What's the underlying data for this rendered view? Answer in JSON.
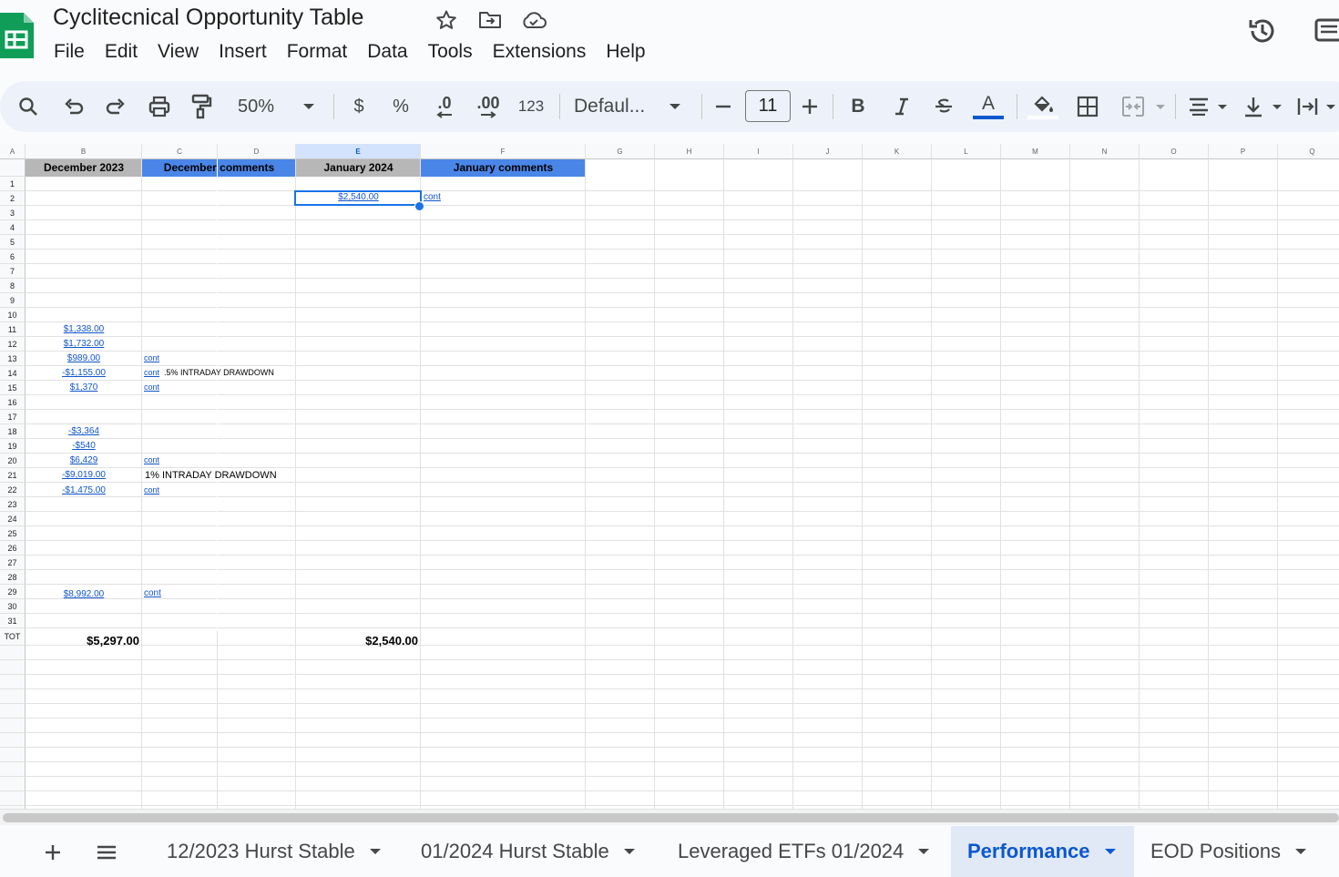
{
  "document": {
    "title": "Cyclitecnical Opportunity Table"
  },
  "menu": [
    "File",
    "Edit",
    "View",
    "Insert",
    "Format",
    "Data",
    "Tools",
    "Extensions",
    "Help"
  ],
  "toolbar": {
    "zoom": "50%",
    "currency_label": "$",
    "percent_label": "%",
    "decrease_decimal_label": ".0",
    "increase_decimal_label": ".00",
    "number_format_label": "123",
    "font_name": "Defaul...",
    "font_size": "11",
    "text_color": "#0b57d0"
  },
  "colors": {
    "header_gray": "#b7b7b7",
    "header_blue": "#4a86e8",
    "link": "#1155cc",
    "selection": "#1a73e8",
    "active_tab": "#0b57d0"
  },
  "grid": {
    "columns": [
      "A",
      "B",
      "C",
      "D",
      "E",
      "F",
      "G",
      "H",
      "I",
      "J",
      "K",
      "L",
      "M",
      "N",
      "O",
      "P",
      "Q"
    ],
    "selected_column": "E",
    "header_row": {
      "b": "December  2023",
      "cd": "December comments",
      "e": "January 2024",
      "f": "January comments"
    },
    "row_labels": [
      "1",
      "2",
      "3",
      "4",
      "5",
      "6",
      "7",
      "8",
      "9",
      "10",
      "11",
      "12",
      "13",
      "14",
      "15",
      "16",
      "17",
      "18",
      "19",
      "20",
      "21",
      "22",
      "23",
      "24",
      "25",
      "26",
      "27",
      "28",
      "29",
      "30",
      "31",
      "TOT"
    ],
    "cells": {
      "e2": "$2,540.00",
      "f2": "cont",
      "b11": "$1,338.00",
      "b12": "$1,732.00",
      "b13": "$989.00",
      "c13": "cont",
      "b14": "-$1,155.00",
      "c14_link": "cont",
      "c14_text": ".5% INTRADAY DRAWDOWN",
      "b15": "$1,370",
      "c15": "cont",
      "b18": "-$3,364",
      "b19": "-$540",
      "b20": "$6,429",
      "c20": "cont",
      "b21": "-$9,019.00",
      "c21": "1% INTRADAY DRAWDOWN",
      "b22": "-$1,475.00",
      "c22": "cont",
      "b29": "$8,992.00",
      "c29": "cont",
      "b_tot": "$5,297.00",
      "e_tot": "$2,540.00"
    }
  },
  "sheet_tabs": [
    {
      "label": "12/2023 Hurst Stable",
      "active": false
    },
    {
      "label": "01/2024 Hurst Stable",
      "active": false
    },
    {
      "label": "Leveraged ETFs 01/2024",
      "active": false
    },
    {
      "label": "Performance",
      "active": true
    },
    {
      "label": "EOD Positions",
      "active": false
    }
  ]
}
